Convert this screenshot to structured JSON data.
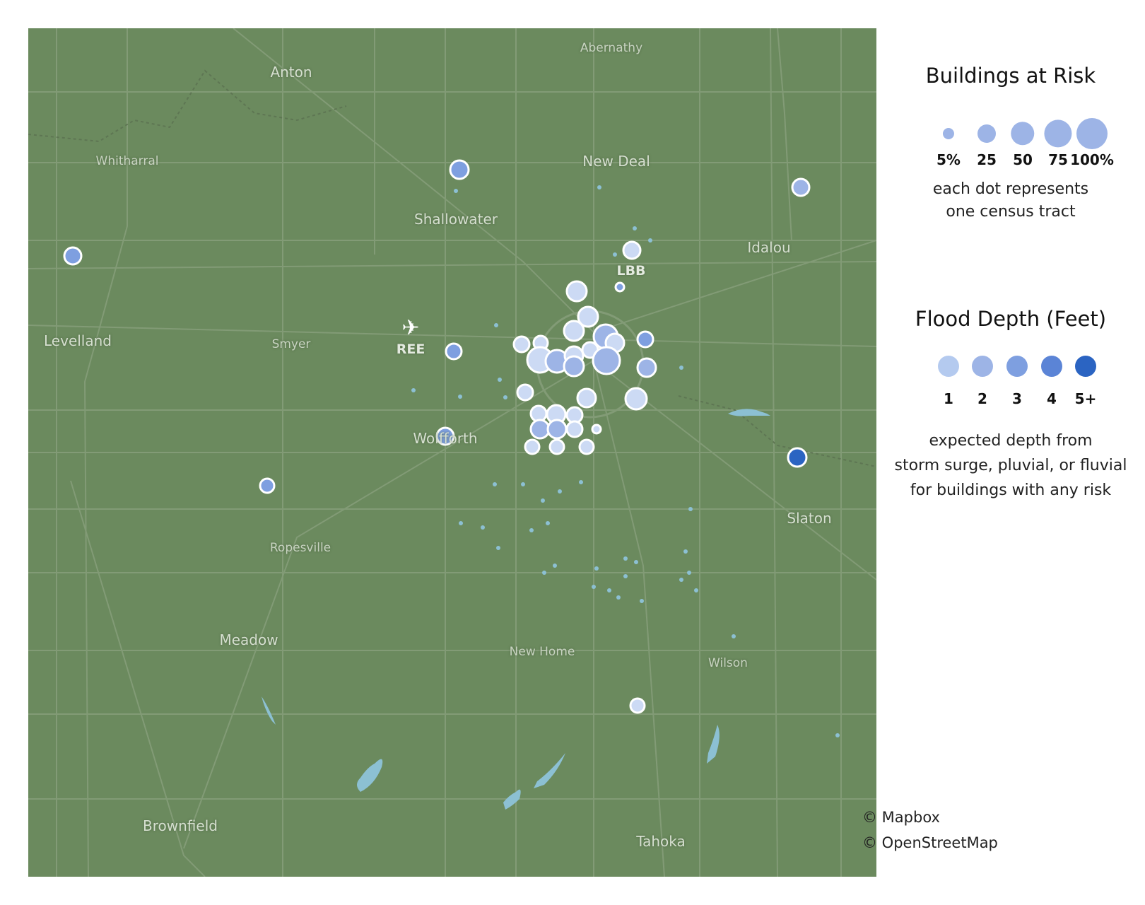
{
  "colors": {
    "land": "#6b8a5e",
    "road": "#869f7a",
    "water": "#8cc0d3",
    "depth_1": "#b4caef",
    "depth_2": "#9db4e6",
    "depth_3": "#7e9fe0",
    "depth_4": "#5b84d6",
    "depth_5plus": "#2b64c2",
    "marker_light": "#ccdaf4",
    "marker_stroke": "#ffffff"
  },
  "map": {
    "places": [
      {
        "name": "Abernathy"
      },
      {
        "name": "Anton"
      },
      {
        "name": "Whitharral"
      },
      {
        "name": "New Deal"
      },
      {
        "name": "Shallowater"
      },
      {
        "name": "Idalou"
      },
      {
        "name": "LBB"
      },
      {
        "name": "Levelland"
      },
      {
        "name": "Smyer"
      },
      {
        "name": "REE"
      },
      {
        "name": "Wolfforth"
      },
      {
        "name": "Slaton"
      },
      {
        "name": "Ropesville"
      },
      {
        "name": "Meadow"
      },
      {
        "name": "New Home"
      },
      {
        "name": "Wilson"
      },
      {
        "name": "Brownfield"
      },
      {
        "name": "Tahoka"
      }
    ],
    "airport_icon": "airplane-icon"
  },
  "legend": {
    "size_title": "Buildings at Risk",
    "size_levels": [
      {
        "label": "5%",
        "value": 5
      },
      {
        "label": "25",
        "value": 25
      },
      {
        "label": "50",
        "value": 50
      },
      {
        "label": "75",
        "value": 75
      },
      {
        "label": "100%",
        "value": 100
      }
    ],
    "size_note_1": "each dot represents",
    "size_note_2": "one census tract",
    "depth_title": "Flood Depth (Feet)",
    "depth_levels": [
      {
        "label": "1",
        "color": "#b4caef"
      },
      {
        "label": "2",
        "color": "#9db4e6"
      },
      {
        "label": "3",
        "color": "#7e9fe0"
      },
      {
        "label": "4",
        "color": "#5b84d6"
      },
      {
        "label": "5+",
        "color": "#2b64c2"
      }
    ],
    "depth_note_1": "expected depth from",
    "depth_note_2": "storm surge, pluvial, or fluvial",
    "depth_note_3": "for buildings with any risk"
  },
  "credits": {
    "mapbox": "© Mapbox",
    "osm": "© OpenStreetMap"
  }
}
